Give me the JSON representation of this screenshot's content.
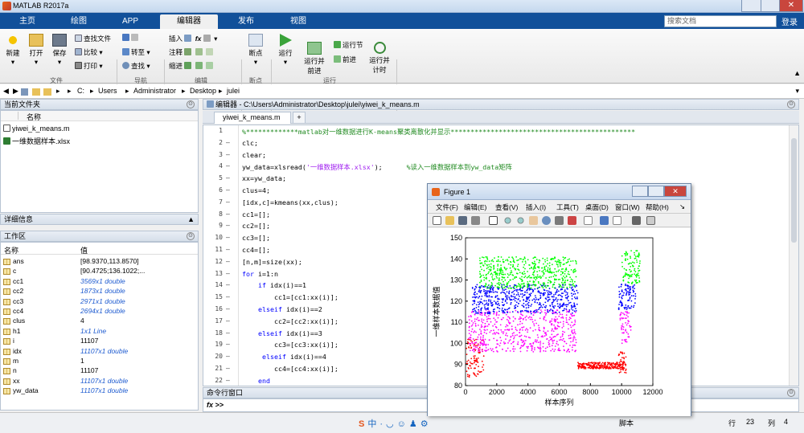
{
  "window": {
    "title": "MATLAB R2017a"
  },
  "ribbon_tabs": [
    "主页",
    "绘图",
    "APP",
    "编辑器",
    "发布",
    "视图"
  ],
  "search_placeholder": "搜索文档",
  "login_label": "登录",
  "ribbon": {
    "file": {
      "new": "新建",
      "open": "打开",
      "save": "保存",
      "find_files": "查找文件",
      "compare": "比较",
      "print": "打印",
      "group": "文件"
    },
    "nav": {
      "goto": "转至",
      "find": "查找",
      "group": "导航"
    },
    "edit": {
      "insert": "插入",
      "comment": "注释",
      "indent": "缩进",
      "fx": "fx",
      "group": "编辑"
    },
    "breakpoints": {
      "label": "断点",
      "group": "断点"
    },
    "run": {
      "run": "运行",
      "run_advance": "运行并\n前进",
      "run_section": "运行节",
      "advance": "前进",
      "run_time": "运行并\n计时",
      "group": "运行"
    }
  },
  "path": {
    "drive": "C:",
    "parts": [
      "Users",
      "Administrator",
      "Desktop",
      "julei"
    ]
  },
  "current_folder": {
    "title": "当前文件夹",
    "col_name": "名称",
    "files": [
      "yiwei_k_means.m",
      "一维数据样本.xlsx"
    ]
  },
  "details": {
    "title": "详细信息"
  },
  "workspace": {
    "title": "工作区",
    "col_name": "名称",
    "col_value": "值",
    "rows": [
      {
        "name": "ans",
        "value": "[98.9370,113.8570]",
        "italic": false
      },
      {
        "name": "c",
        "value": "[90.4725;136.1022;...",
        "italic": false
      },
      {
        "name": "cc1",
        "value": "3569x1 double",
        "italic": true
      },
      {
        "name": "cc2",
        "value": "1873x1 double",
        "italic": true
      },
      {
        "name": "cc3",
        "value": "2971x1 double",
        "italic": true
      },
      {
        "name": "cc4",
        "value": "2694x1 double",
        "italic": true
      },
      {
        "name": "clus",
        "value": "4",
        "italic": false
      },
      {
        "name": "h1",
        "value": "1x1 Line",
        "italic": true
      },
      {
        "name": "i",
        "value": "11107",
        "italic": false
      },
      {
        "name": "idx",
        "value": "11107x1 double",
        "italic": true
      },
      {
        "name": "m",
        "value": "1",
        "italic": false
      },
      {
        "name": "n",
        "value": "11107",
        "italic": false
      },
      {
        "name": "xx",
        "value": "11107x1 double",
        "italic": true
      },
      {
        "name": "yw_data",
        "value": "11107x1 double",
        "italic": true
      }
    ]
  },
  "editor": {
    "title": "编辑器 - C:\\Users\\Administrator\\Desktop\\julei\\yiwei_k_means.m",
    "tab": "yiwei_k_means.m",
    "lines": [
      {
        "n": "1",
        "dash": "",
        "code": "%*************matlab对一维数据进行K-means聚类离散化并显示**********************************************"
      },
      {
        "n": "2",
        "dash": "—",
        "code": "clc;"
      },
      {
        "n": "3",
        "dash": "—",
        "code": "clear;"
      },
      {
        "n": "4",
        "dash": "—",
        "code": "yw_data=xlsread('一维数据样本.xlsx');      %读入一维数据样本到yw_data矩阵"
      },
      {
        "n": "5",
        "dash": "—",
        "code": "xx=yw_data;"
      },
      {
        "n": "6",
        "dash": "—",
        "code": "clus=4;"
      },
      {
        "n": "7",
        "dash": "—",
        "code": "[idx,c]=kmeans(xx,clus);"
      },
      {
        "n": "8",
        "dash": "—",
        "code": "cc1=[];"
      },
      {
        "n": "9",
        "dash": "—",
        "code": "cc2=[];"
      },
      {
        "n": "10",
        "dash": "—",
        "code": "cc3=[];"
      },
      {
        "n": "11",
        "dash": "—",
        "code": "cc4=[];"
      },
      {
        "n": "12",
        "dash": "—",
        "code": "[n,m]=size(xx);"
      },
      {
        "n": "13",
        "dash": "—",
        "code": "for i=1:n"
      },
      {
        "n": "14",
        "dash": "—",
        "code": "    if idx(i)==1"
      },
      {
        "n": "15",
        "dash": "—",
        "code": "        cc1=[cc1:xx(i)];"
      },
      {
        "n": "16",
        "dash": "—",
        "code": "    elseif idx(i)==2"
      },
      {
        "n": "17",
        "dash": "—",
        "code": "        cc2=[cc2:xx(i)];"
      },
      {
        "n": "18",
        "dash": "—",
        "code": "    elseif idx(i)==3"
      },
      {
        "n": "19",
        "dash": "—",
        "code": "        cc3=[cc3:xx(i)];"
      },
      {
        "n": "20",
        "dash": "—",
        "code": "     elseif idx(i)==4"
      },
      {
        "n": "21",
        "dash": "—",
        "code": "        cc4=[cc4:xx(i)];"
      },
      {
        "n": "22",
        "dash": "—",
        "code": "    end"
      }
    ]
  },
  "command_window": {
    "title": "命令行窗口",
    "prompt": "fx >>"
  },
  "status": {
    "mode": "脚本",
    "row_label": "行",
    "row": "23",
    "col_label": "列",
    "col": "4"
  },
  "figure": {
    "title": "Figure 1",
    "menu": [
      "文件(F)",
      "编辑(E)",
      "查看(V)",
      "插入(I)",
      "工具(T)",
      "桌面(D)",
      "窗口(W)",
      "帮助(H)"
    ],
    "xlabel": "样本序列",
    "ylabel": "一维样本数据值"
  },
  "chart_data": {
    "type": "scatter",
    "xlabel": "样本序列",
    "ylabel": "一维样本数据值",
    "xlim": [
      0,
      12000
    ],
    "ylim": [
      80,
      150
    ],
    "xticks": [
      0,
      2000,
      4000,
      6000,
      8000,
      10000,
      12000
    ],
    "yticks": [
      80,
      90,
      100,
      110,
      120,
      130,
      140,
      150
    ],
    "series": [
      {
        "color": "#ff0000",
        "segments": [
          [
            50,
            1200,
            84,
            102
          ],
          [
            7200,
            10200,
            88,
            91
          ],
          [
            9800,
            10300,
            86,
            96
          ]
        ]
      },
      {
        "color": "#ff00ff",
        "segments": [
          [
            200,
            7100,
            96,
            116
          ],
          [
            9900,
            10600,
            100,
            115
          ]
        ]
      },
      {
        "color": "#0000ff",
        "segments": [
          [
            400,
            7200,
            114,
            128
          ],
          [
            9800,
            10900,
            116,
            128
          ]
        ]
      },
      {
        "color": "#00ff00",
        "segments": [
          [
            900,
            7100,
            126,
            141
          ],
          [
            10000,
            11200,
            128,
            144
          ]
        ]
      }
    ],
    "grid": false
  },
  "colors": {
    "ribbon_blue": "#11509a",
    "accent": "#f0f0f0"
  }
}
